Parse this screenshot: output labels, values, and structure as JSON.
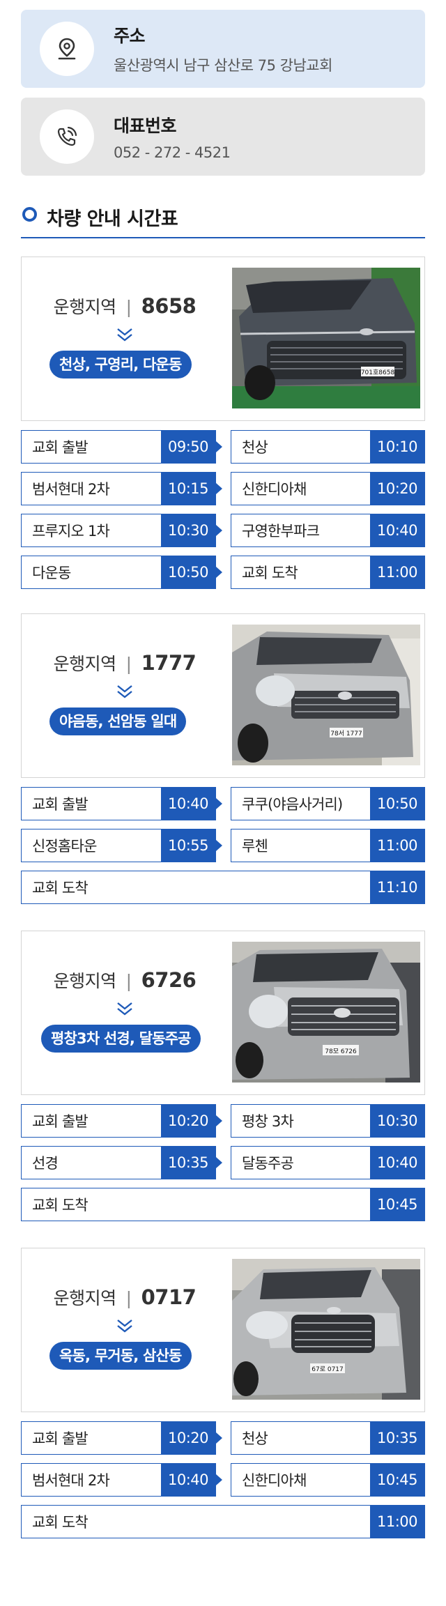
{
  "address": {
    "title": "주소",
    "value": "울산광역시 남구 삼산로 75 강남교회",
    "icon": "location-pin-icon"
  },
  "phone": {
    "title": "대표번호",
    "value": "052 - 272 - 4521",
    "icon": "phone-icon"
  },
  "section_title": "차량 안내 시간표",
  "colors": {
    "accent": "#1e5ab8",
    "address_bg": "#dde8f6",
    "phone_bg": "#e6e6e6"
  },
  "routes": [
    {
      "label": "운행지역",
      "number": "8658",
      "area": "천상, 구영리, 다운동",
      "plate": "701호8658",
      "stops": [
        {
          "name": "교회 출발",
          "time": "09:50"
        },
        {
          "name": "천상",
          "time": "10:10"
        },
        {
          "name": "범서현대 2차",
          "time": "10:15"
        },
        {
          "name": "신한디아채",
          "time": "10:20"
        },
        {
          "name": "프루지오 1차",
          "time": "10:30"
        },
        {
          "name": "구영한부파크",
          "time": "10:40"
        },
        {
          "name": "다운동",
          "time": "10:50"
        },
        {
          "name": "교회 도착",
          "time": "11:00"
        }
      ]
    },
    {
      "label": "운행지역",
      "number": "1777",
      "area": "야음동, 선암동 일대",
      "plate": "78서 1777",
      "stops": [
        {
          "name": "교회 출발",
          "time": "10:40"
        },
        {
          "name": "쿠쿠(야음사거리)",
          "time": "10:50"
        },
        {
          "name": "신정홈타운",
          "time": "10:55"
        },
        {
          "name": "루첸",
          "time": "11:00"
        },
        {
          "name": "교회 도착",
          "time": "11:10"
        }
      ]
    },
    {
      "label": "운행지역",
      "number": "6726",
      "area": "평창3차 선경, 달동주공",
      "plate": "78모 6726",
      "stops": [
        {
          "name": "교회 출발",
          "time": "10:20"
        },
        {
          "name": "평창 3차",
          "time": "10:30"
        },
        {
          "name": "선경",
          "time": "10:35"
        },
        {
          "name": "달동주공",
          "time": "10:40"
        },
        {
          "name": "교회 도착",
          "time": "10:45"
        }
      ]
    },
    {
      "label": "운행지역",
      "number": "0717",
      "area": "옥동, 무거동, 삼산동",
      "plate": "67로 0717",
      "stops": [
        {
          "name": "교회 출발",
          "time": "10:20"
        },
        {
          "name": "천상",
          "time": "10:35"
        },
        {
          "name": "범서현대 2차",
          "time": "10:40"
        },
        {
          "name": "신한디아채",
          "time": "10:45"
        },
        {
          "name": "교회 도착",
          "time": "11:00"
        }
      ]
    }
  ]
}
